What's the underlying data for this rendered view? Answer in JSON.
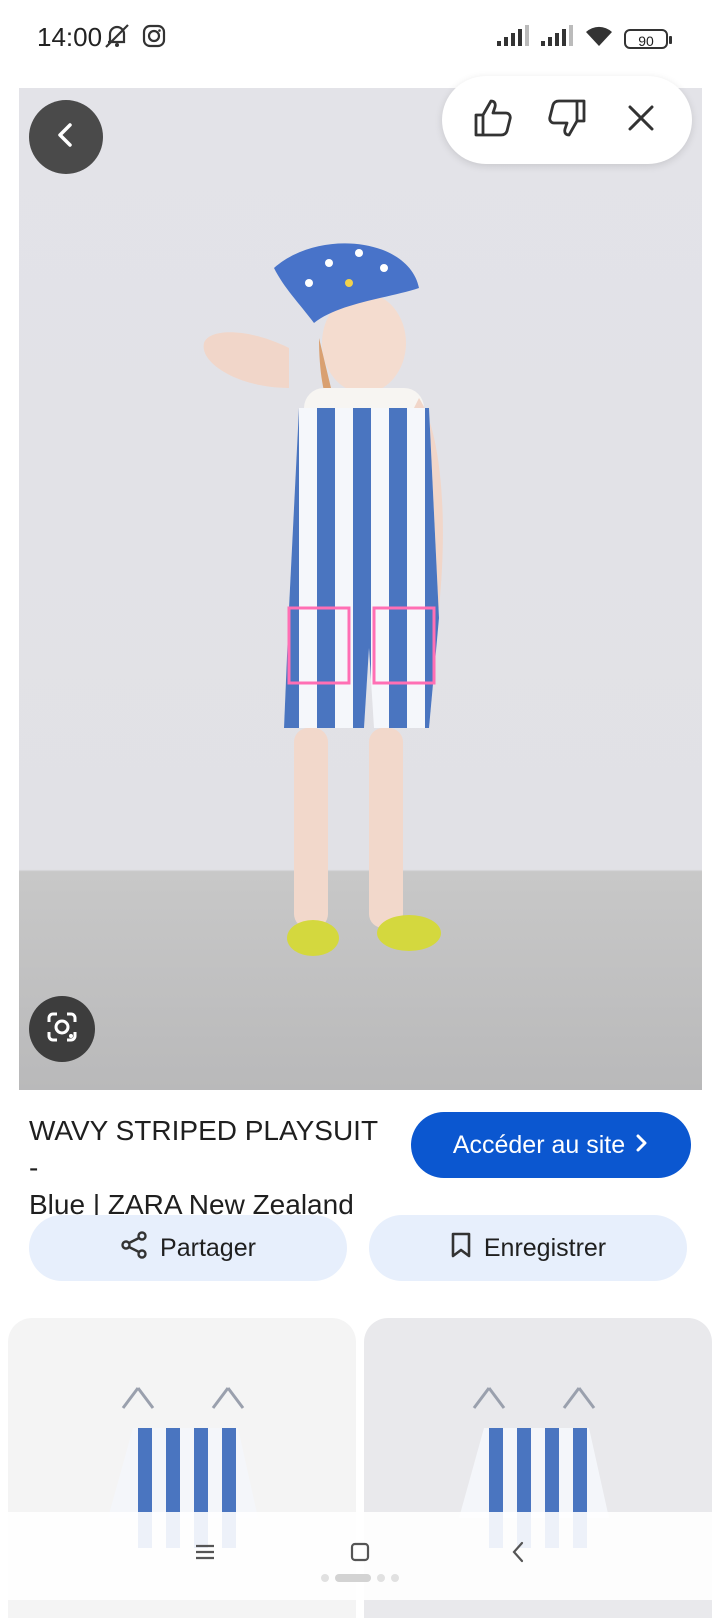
{
  "status_bar": {
    "time": "14:00",
    "battery": "90"
  },
  "product": {
    "title_line1": "WAVY STRIPED PLAYSUIT -",
    "title_line2": "Blue | ZARA New Zealand"
  },
  "buttons": {
    "visit_site": "Accéder au site",
    "share": "Partager",
    "save": "Enregistrer"
  },
  "icons": {
    "back": "chevron-left-icon",
    "lens": "google-lens-icon",
    "thumbs_up": "thumbs-up-icon",
    "thumbs_down": "thumbs-down-icon",
    "close": "close-icon",
    "share": "share-icon",
    "bookmark": "bookmark-icon"
  },
  "colors": {
    "accent": "#0b57d0",
    "chip_bg": "#e7effc"
  }
}
